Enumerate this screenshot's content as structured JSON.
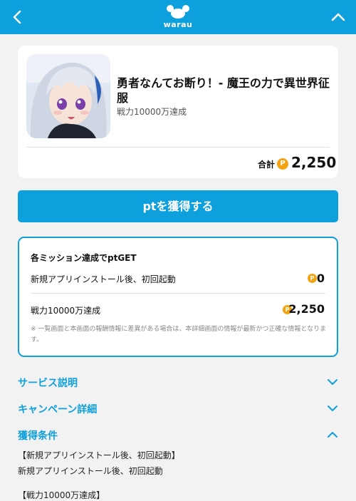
{
  "header": {
    "logo_text": "warau",
    "back_icon": "chevron-left-icon",
    "up_icon": "chevron-up-icon",
    "background": "#0ea0dc"
  },
  "offer": {
    "title": "勇者なんてお断り！- 魔王の力で異世界征服",
    "subtitle": "戦力10000万達成",
    "total_label": "合計",
    "total_points": "2,250",
    "coin_symbol": "P"
  },
  "cta": {
    "label": "ptを獲得する"
  },
  "missions": {
    "heading": "各ミッション達成でptGET",
    "items": [
      {
        "label": "新規アプリインストール後、初回起動",
        "points": "0"
      },
      {
        "label": "戦力10000万達成",
        "points": "2,250"
      }
    ],
    "note": "※ 一覧画面と本画面の報酬情報に差異がある場合は、本詳細画面の情報が最新かつ正確な情報となります。"
  },
  "sections": {
    "service": {
      "label": "サービス説明",
      "state": "collapsed"
    },
    "campaign": {
      "label": "キャンペーン詳細",
      "state": "collapsed"
    },
    "conditions": {
      "label": "獲得条件",
      "state": "expanded",
      "lines": [
        "【新規アプリインストール後、初回起動】",
        "新規アプリインストール後、初回起動",
        "【戦力10000万達成】"
      ]
    }
  },
  "colors": {
    "accent": "#0ea0dc",
    "coin": "#f2a30f",
    "page_bg": "#f2f2f2"
  }
}
